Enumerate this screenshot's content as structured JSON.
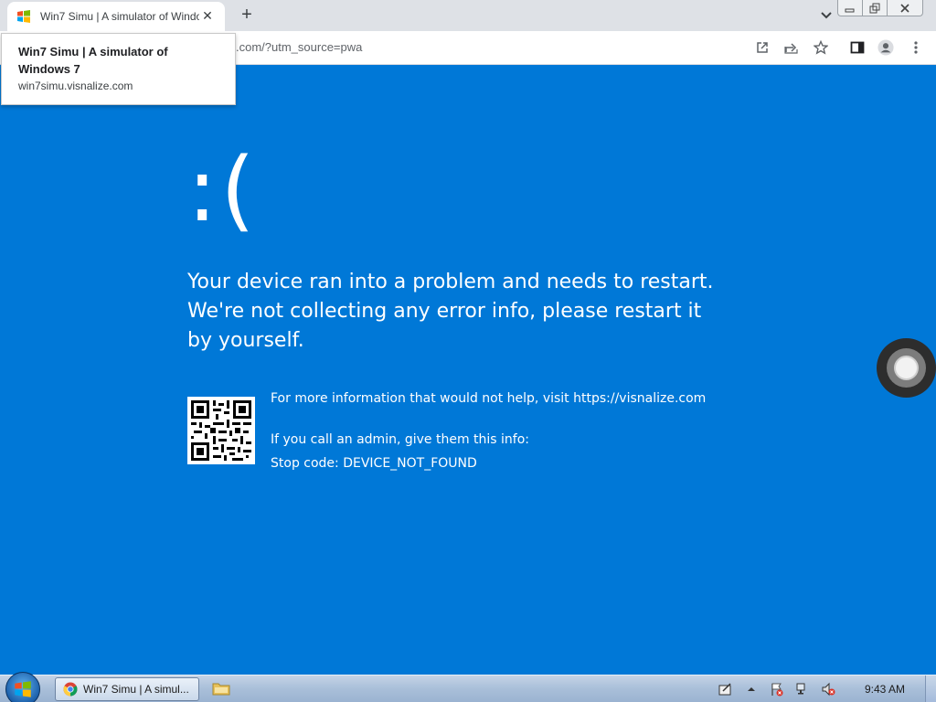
{
  "browser": {
    "tab_title": "Win7 Simu | A simulator of Windows 7",
    "tab_close": "✕",
    "new_tab": "+",
    "url_visible": ".com/?utm_source=pwa",
    "tooltip_title": "Win7 Simu | A simulator of Windows 7",
    "tooltip_url": "win7simu.visnalize.com"
  },
  "bsod": {
    "face": ":(",
    "headline": "Your device ran into a problem and needs to restart. We're not collecting any error info, please restart it by yourself.",
    "more_info": "For more information that would not help, visit https://visnalize.com",
    "admin_info": "If you call an admin, give them this info:",
    "stop_code": "Stop code: DEVICE_NOT_FOUND"
  },
  "taskbar": {
    "task_label": "Win7 Simu | A simul...",
    "clock": "9:43 AM"
  },
  "colors": {
    "bsod_blue": "#0078d7",
    "chrome_frame": "#dee1e6"
  },
  "icons": [
    "windows-favicon",
    "close-icon",
    "plus-icon",
    "chevron-down-icon",
    "minimize-icon",
    "restore-icon",
    "open-in-app-icon",
    "share-icon",
    "star-icon",
    "side-panel-icon",
    "profile-icon",
    "more-vert-icon",
    "qr-code",
    "floating-ring-button",
    "start-orb-icon",
    "chrome-icon",
    "folder-icon",
    "action-center-icon",
    "volume-muted-icon",
    "network-icon",
    "flag-icon"
  ]
}
